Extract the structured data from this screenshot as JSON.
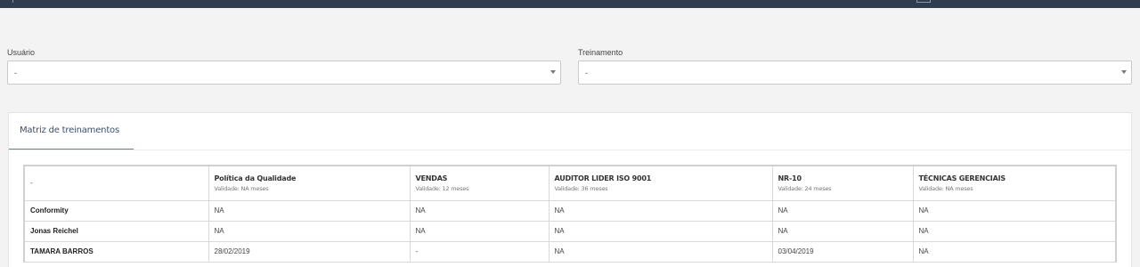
{
  "filters": {
    "user": {
      "label": "Usuário",
      "value": "-"
    },
    "training": {
      "label": "Treinamento",
      "value": "-"
    }
  },
  "matrix": {
    "title": "Matriz de treinamentos",
    "corner": "-",
    "columns": [
      {
        "name": "Política da Qualidade",
        "validity": "Validade: NA meses"
      },
      {
        "name": "VENDAS",
        "validity": "Validade: 12 meses"
      },
      {
        "name": "AUDITOR LIDER ISO 9001",
        "validity": "Validade: 36 meses"
      },
      {
        "name": "NR-10",
        "validity": "Validade: 24 meses"
      },
      {
        "name": "TÉCNICAS GERENCIAIS",
        "validity": "Validade: NA meses"
      }
    ],
    "rows": [
      {
        "user": "Conformity",
        "cells": [
          "NA",
          "NA",
          "NA",
          "NA",
          "NA"
        ]
      },
      {
        "user": "Jonas Reichel",
        "cells": [
          "NA",
          "NA",
          "NA",
          "NA",
          "NA"
        ]
      },
      {
        "user": "TAMARA BARROS",
        "cells": [
          "28/02/2019",
          "-",
          "NA",
          "03/04/2019",
          "NA"
        ]
      }
    ]
  }
}
